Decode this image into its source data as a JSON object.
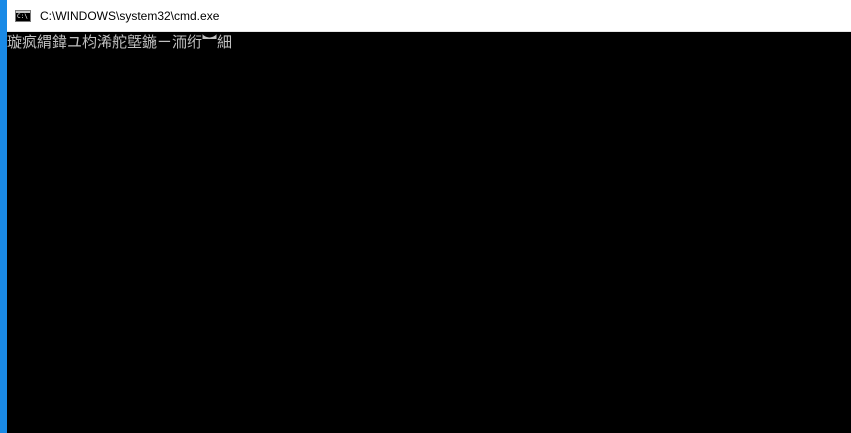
{
  "window": {
    "title": "C:\\WINDOWS\\system32\\cmd.exe",
    "icon": "console-icon",
    "accent_color": "#1a8ae6"
  },
  "console": {
    "background_color": "#000000",
    "text_color": "#c0c0c0",
    "lines": [
      "璇疯緭鍏ユ枃浠舵墍鍦ㄧ洏绗︼細"
    ]
  }
}
